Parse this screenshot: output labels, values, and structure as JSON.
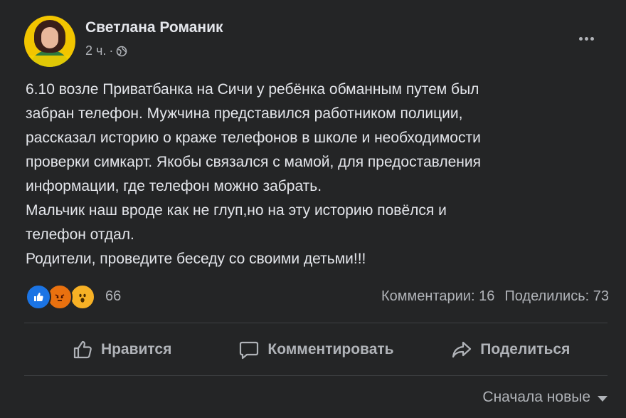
{
  "post": {
    "author": "Светлана Романик",
    "time": "2 ч.",
    "separator": "·",
    "lines": [
      "6.10 возле Приватбанка на Сичи у ребёнка обманным путем был",
      "забран телефон. Мужчина представился работником полиции,",
      "рассказал историю о краже телефонов в школе и необходимости",
      "проверки симкарт. Якобы связался с мамой, для предоставления",
      "информации, где телефон можно забрать.",
      "Мальчик наш вроде как не глуп,но на эту историю повёлся и",
      "телефон отдал.",
      "Родители, проведите беседу со своими детьми!!!"
    ]
  },
  "reactions": {
    "icons": [
      "like-icon",
      "angry-icon",
      "wow-icon"
    ],
    "count": "66",
    "comments": "Комментарии: 16",
    "shares": "Поделились: 73"
  },
  "actions": {
    "like": "Нравится",
    "comment": "Комментировать",
    "share": "Поделиться"
  },
  "sort": {
    "label": "Сначала новые"
  },
  "colors": {
    "background": "#242526",
    "text": "#e4e6eb",
    "secondary": "#b0b3b8",
    "like_blue": "#1b74e4"
  }
}
